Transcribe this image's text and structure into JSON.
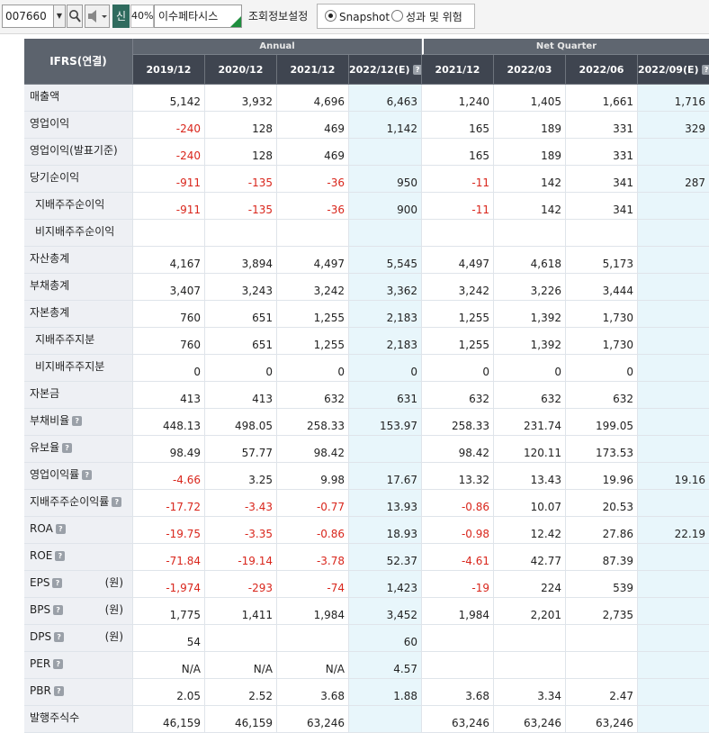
{
  "toolbar": {
    "stock_code": "007660",
    "new_badge": "신",
    "margin_pct": "40%",
    "company_name": "이수페타시스",
    "settings_label": "조회정보설정",
    "radio_snapshot": "Snapshot",
    "radio_perf_risk": "성과 및 위험",
    "selected_radio": "Snapshot"
  },
  "table": {
    "corner_label": "IFRS(연결)",
    "group_annual": "Annual",
    "group_quarter": "Net Quarter",
    "columns": [
      "2019/12",
      "2020/12",
      "2021/12",
      "2022/12(E)",
      "2021/12",
      "2022/03",
      "2022/06",
      "2022/09(E)"
    ],
    "estimate_columns": [
      3,
      7
    ],
    "help_columns": [
      3,
      7
    ],
    "rows": [
      {
        "label": "매출액",
        "indent": false,
        "help": false,
        "unit": "",
        "values": [
          "5,142",
          "3,932",
          "4,696",
          "6,463",
          "1,240",
          "1,405",
          "1,661",
          "1,716"
        ]
      },
      {
        "label": "영업이익",
        "indent": false,
        "help": false,
        "unit": "",
        "values": [
          "-240",
          "128",
          "469",
          "1,142",
          "165",
          "189",
          "331",
          "329"
        ]
      },
      {
        "label": "영업이익(발표기준)",
        "indent": false,
        "help": false,
        "unit": "",
        "values": [
          "-240",
          "128",
          "469",
          "",
          "165",
          "189",
          "331",
          ""
        ]
      },
      {
        "label": "당기순이익",
        "indent": false,
        "help": false,
        "unit": "",
        "values": [
          "-911",
          "-135",
          "-36",
          "950",
          "-11",
          "142",
          "341",
          "287"
        ]
      },
      {
        "label": "지배주주순이익",
        "indent": true,
        "help": false,
        "unit": "",
        "values": [
          "-911",
          "-135",
          "-36",
          "900",
          "-11",
          "142",
          "341",
          ""
        ]
      },
      {
        "label": "비지배주주순이익",
        "indent": true,
        "help": false,
        "unit": "",
        "values": [
          "",
          "",
          "",
          "",
          "",
          "",
          "",
          ""
        ]
      },
      {
        "label": "자산총계",
        "indent": false,
        "help": false,
        "unit": "",
        "values": [
          "4,167",
          "3,894",
          "4,497",
          "5,545",
          "4,497",
          "4,618",
          "5,173",
          ""
        ]
      },
      {
        "label": "부채총계",
        "indent": false,
        "help": false,
        "unit": "",
        "values": [
          "3,407",
          "3,243",
          "3,242",
          "3,362",
          "3,242",
          "3,226",
          "3,444",
          ""
        ]
      },
      {
        "label": "자본총계",
        "indent": false,
        "help": false,
        "unit": "",
        "values": [
          "760",
          "651",
          "1,255",
          "2,183",
          "1,255",
          "1,392",
          "1,730",
          ""
        ]
      },
      {
        "label": "지배주주지분",
        "indent": true,
        "help": false,
        "unit": "",
        "values": [
          "760",
          "651",
          "1,255",
          "2,183",
          "1,255",
          "1,392",
          "1,730",
          ""
        ]
      },
      {
        "label": "비지배주주지분",
        "indent": true,
        "help": false,
        "unit": "",
        "values": [
          "0",
          "0",
          "0",
          "0",
          "0",
          "0",
          "0",
          ""
        ]
      },
      {
        "label": "자본금",
        "indent": false,
        "help": false,
        "unit": "",
        "values": [
          "413",
          "413",
          "632",
          "631",
          "632",
          "632",
          "632",
          ""
        ]
      },
      {
        "label": "부채비율",
        "indent": false,
        "help": true,
        "unit": "",
        "values": [
          "448.13",
          "498.05",
          "258.33",
          "153.97",
          "258.33",
          "231.74",
          "199.05",
          ""
        ]
      },
      {
        "label": "유보율",
        "indent": false,
        "help": true,
        "unit": "",
        "values": [
          "98.49",
          "57.77",
          "98.42",
          "",
          "98.42",
          "120.11",
          "173.53",
          ""
        ]
      },
      {
        "label": "영업이익률",
        "indent": false,
        "help": true,
        "unit": "",
        "values": [
          "-4.66",
          "3.25",
          "9.98",
          "17.67",
          "13.32",
          "13.43",
          "19.96",
          "19.16"
        ]
      },
      {
        "label": "지배주주순이익률",
        "indent": false,
        "help": true,
        "unit": "",
        "values": [
          "-17.72",
          "-3.43",
          "-0.77",
          "13.93",
          "-0.86",
          "10.07",
          "20.53",
          ""
        ]
      },
      {
        "label": "ROA",
        "indent": false,
        "help": true,
        "unit": "",
        "values": [
          "-19.75",
          "-3.35",
          "-0.86",
          "18.93",
          "-0.98",
          "12.42",
          "27.86",
          "22.19"
        ]
      },
      {
        "label": "ROE",
        "indent": false,
        "help": true,
        "unit": "",
        "values": [
          "-71.84",
          "-19.14",
          "-3.78",
          "52.37",
          "-4.61",
          "42.77",
          "87.39",
          ""
        ]
      },
      {
        "label": "EPS",
        "indent": false,
        "help": true,
        "unit": "(원)",
        "values": [
          "-1,974",
          "-293",
          "-74",
          "1,423",
          "-19",
          "224",
          "539",
          ""
        ]
      },
      {
        "label": "BPS",
        "indent": false,
        "help": true,
        "unit": "(원)",
        "values": [
          "1,775",
          "1,411",
          "1,984",
          "3,452",
          "1,984",
          "2,201",
          "2,735",
          ""
        ]
      },
      {
        "label": "DPS",
        "indent": false,
        "help": true,
        "unit": "(원)",
        "values": [
          "54",
          "",
          "",
          "60",
          "",
          "",
          "",
          ""
        ]
      },
      {
        "label": "PER",
        "indent": false,
        "help": true,
        "unit": "",
        "values": [
          "N/A",
          "N/A",
          "N/A",
          "4.57",
          "",
          "",
          "",
          ""
        ]
      },
      {
        "label": "PBR",
        "indent": false,
        "help": true,
        "unit": "",
        "values": [
          "2.05",
          "2.52",
          "3.68",
          "1.88",
          "3.68",
          "3.34",
          "2.47",
          ""
        ]
      },
      {
        "label": "발행주식수",
        "indent": false,
        "help": false,
        "unit": "",
        "values": [
          "46,159",
          "46,159",
          "63,246",
          "",
          "63,246",
          "63,246",
          "63,246",
          ""
        ]
      }
    ]
  },
  "colors": {
    "negative": "#d9261c",
    "estimate_bg": "#e8f6fb",
    "header_bg": "#3f4550",
    "label_bg": "#eef0f4"
  },
  "icons": {
    "help": "help-icon",
    "search": "search-icon",
    "speaker": "speaker-icon",
    "dropdown": "chevron-down-icon"
  }
}
